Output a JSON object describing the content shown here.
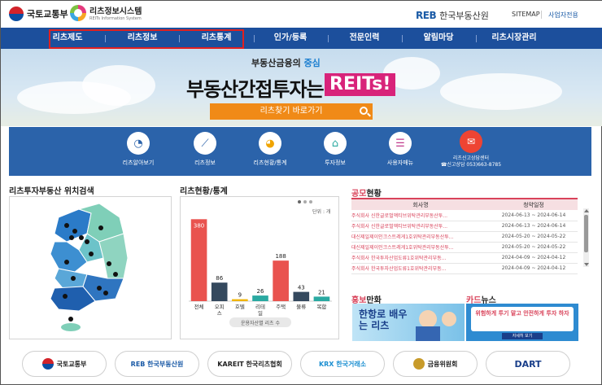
{
  "header": {
    "molit": "국토교통부",
    "reits_title": "리츠정보시스템",
    "reits_subtitle": "REITs Information System",
    "reb_mark": "REB",
    "reb_name": "한국부동산원",
    "sitemap": "SITEMAP",
    "operator": "사업자전용"
  },
  "nav": [
    "리츠제도",
    "리츠정보",
    "리츠통계",
    "인가/등록",
    "전문인력",
    "알림마당",
    "리츠시장관리"
  ],
  "hero": {
    "subtitle_pre": "부동산금융의 ",
    "subtitle_em": "중심",
    "main": "부동산간접투자는",
    "badge": "REITs!",
    "search_label": "리츠찾기 바로가기"
  },
  "quick": [
    {
      "label": "리츠알아보기",
      "icon": "chart-icon"
    },
    {
      "label": "리츠정보",
      "icon": "graph-icon"
    },
    {
      "label": "리츠현황/통계",
      "icon": "pie-icon"
    },
    {
      "label": "투자정보",
      "icon": "house-icon"
    },
    {
      "label": "사용자매뉴",
      "icon": "manual-icon"
    }
  ],
  "callcenter": {
    "title": "리츠신고상담센터",
    "phone": "☎신고상담 053)663-8785"
  },
  "sections": {
    "map_title": "리츠투자부동산 위치검색",
    "stats_title": "리츠현황/통계",
    "ann_title_em": "공모",
    "ann_title": "현황",
    "promo_em": "홍보",
    "promo": "만화",
    "card_em": "카드",
    "card": "뉴스"
  },
  "stats_extra": {
    "unit": "단위 : 개",
    "footer": "운용자산별 리츠 수"
  },
  "chart_data": {
    "type": "bar",
    "categories": [
      "전체",
      "오피스",
      "호텔",
      "리테일",
      "주택",
      "물류",
      "복합"
    ],
    "values": [
      380,
      86,
      9,
      26,
      188,
      43,
      21
    ],
    "colors": [
      "#e9534f",
      "#34495e",
      "#f0b400",
      "#2aa9a1",
      "#e9534f",
      "#34495e",
      "#2aa9a1"
    ],
    "ylim": [
      0,
      400
    ]
  },
  "announcements": {
    "headers": [
      "회사명",
      "청약일정"
    ],
    "rows": [
      [
        "주식회사 신한글로벌액티브위탁관리부동산투...",
        "2024-06-13 ~ 2024-06-14"
      ],
      [
        "주식회사 신한글로벌액티브위탁관리부동산투...",
        "2024-06-13 ~ 2024-06-14"
      ],
      [
        "대신제일제이인크스트레게1호위탁관리부동산투...",
        "2024-05-20 ~ 2024-05-22"
      ],
      [
        "대신제일제이인크스트레게1호위탁관리부동산투...",
        "2024-05-20 ~ 2024-05-22"
      ],
      [
        "주식회사 한국투자산업도류1호위탁관리부동...",
        "2024-04-09 ~ 2024-04-12"
      ],
      [
        "주식회사 한국투자산업도류1호위탁관리부동...",
        "2024-04-09 ~ 2024-04-12"
      ]
    ]
  },
  "banners": {
    "comic": "한항로 배우는 리츠",
    "card": "위험하게 투기 말고 안전하게 투자 하자",
    "card_btn": "자세히 보기"
  },
  "partners": [
    "국토교통부",
    "REB 한국부동산원",
    "KAREIT 한국리츠협회",
    "KRX 한국거래소",
    "금융위원회",
    "DART"
  ]
}
